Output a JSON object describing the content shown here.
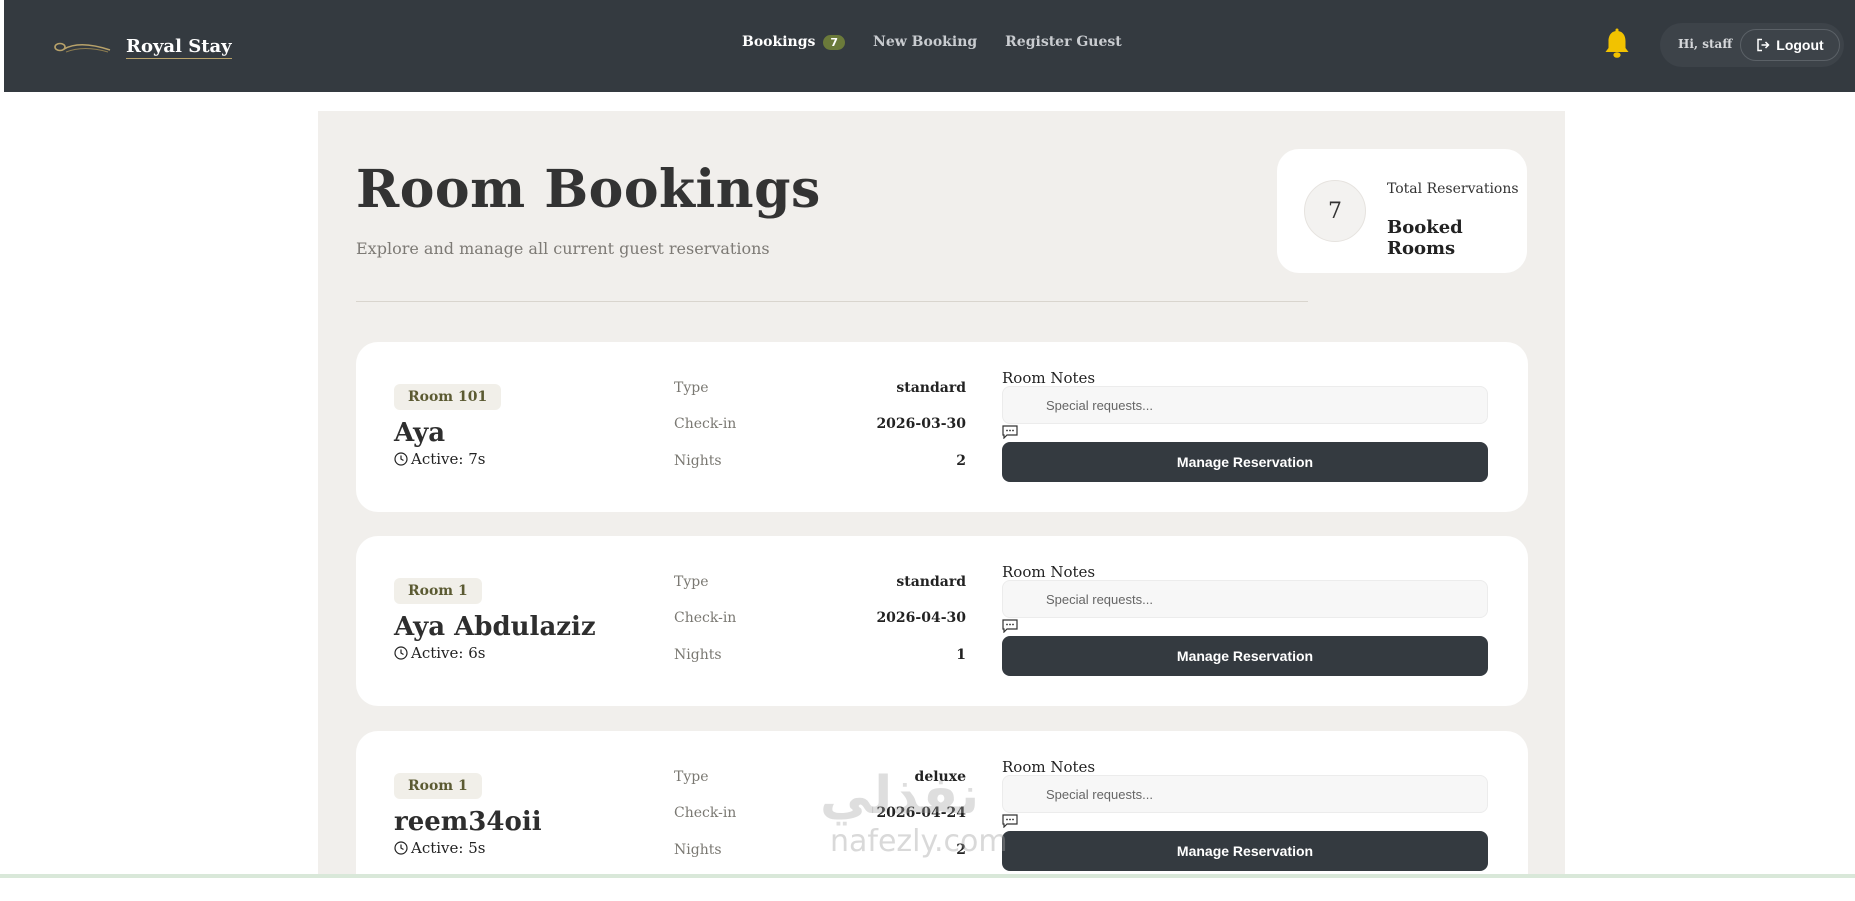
{
  "navbar": {
    "brand": "Royal Stay",
    "links": [
      {
        "label": "Bookings",
        "badge": "7"
      },
      {
        "label": "New Booking"
      },
      {
        "label": "Register Guest"
      }
    ],
    "greeting": "Hi, staff",
    "logout_label": "Logout"
  },
  "header": {
    "title": "Room Bookings",
    "subtitle": "Explore and manage all current guest reservations"
  },
  "stats": {
    "count": "7",
    "label": "Total Reservations",
    "value": "Booked Rooms"
  },
  "bookings": [
    {
      "room": "Room 101",
      "guest": "Aya",
      "active": "Active: 7s",
      "type_label": "Type",
      "type": "standard",
      "checkin_label": "Check-in",
      "checkin": "2026-03-30",
      "nights_label": "Nights",
      "nights": "2",
      "notes_label": "Room Notes",
      "notes_placeholder": "Special requests...",
      "button": "Manage Reservation"
    },
    {
      "room": "Room 1",
      "guest": "Aya Abdulaziz",
      "active": "Active: 6s",
      "type_label": "Type",
      "type": "standard",
      "checkin_label": "Check-in",
      "checkin": "2026-04-30",
      "nights_label": "Nights",
      "nights": "1",
      "notes_label": "Room Notes",
      "notes_placeholder": "Special requests...",
      "button": "Manage Reservation"
    },
    {
      "room": "Room 1",
      "guest": "reem34oii",
      "active": "Active: 5s",
      "type_label": "Type",
      "type": "deluxe",
      "checkin_label": "Check-in",
      "checkin": "2026-04-24",
      "nights_label": "Nights",
      "nights": "2",
      "notes_label": "Room Notes",
      "notes_placeholder": "Special requests...",
      "button": "Manage Reservation"
    }
  ],
  "watermark": {
    "arabic": "نفذلي",
    "latin": "nafezly.com"
  },
  "colors": {
    "navbar": "#343a40",
    "panel": "#f1efec",
    "badge": "#6b7a3a",
    "bell": "#f2c200",
    "button": "#343a40"
  }
}
